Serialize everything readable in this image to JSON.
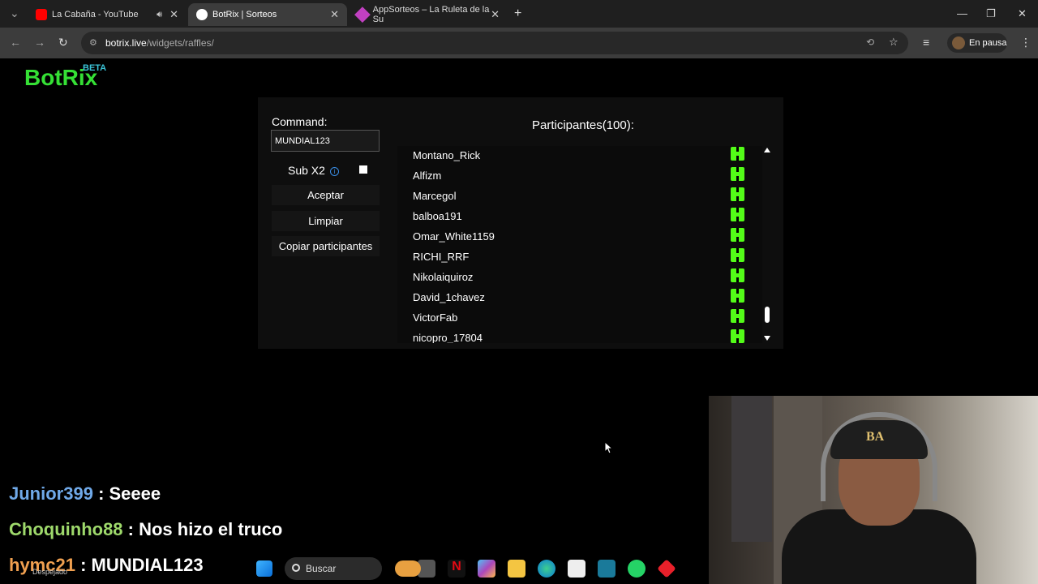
{
  "browser": {
    "tabs": [
      {
        "label": "La Cabaña - YouTube",
        "icon": "youtube-icon"
      },
      {
        "label": "BotRix | Sorteos",
        "icon": "botrix-icon"
      },
      {
        "label": "AppSorteos – La Ruleta de la Su",
        "icon": "appsorteos-icon"
      }
    ],
    "url_host": "botrix.live",
    "url_path": "/widgets/raffles/",
    "profile_label": "En pausa"
  },
  "brand": {
    "name": "BotRix",
    "badge": "BETA"
  },
  "raffle": {
    "command_label": "Command:",
    "command_value": "MUNDIAL123",
    "subx2_label": "Sub X2",
    "subx2_checked": false,
    "accept_label": "Aceptar",
    "clear_label": "Limpiar",
    "copy_label": "Copiar participantes",
    "participants_title": "Participantes(100):",
    "participants": [
      "Montano_Rick",
      "Alfizm",
      "Marcegol",
      "balboa191",
      "Omar_White1159",
      "RICHI_RRF",
      "Nikolaiquiroz",
      "David_1chavez",
      "VictorFab",
      "nicopro_17804"
    ],
    "platform_color": "#53fc18"
  },
  "chat": [
    {
      "user": "Junior399",
      "message": ": Seeee"
    },
    {
      "user": "Choquinho88",
      "message": ": Nos hizo el truco"
    },
    {
      "user": "hymc21",
      "message": ": MUNDIAL123"
    }
  ],
  "taskbar": {
    "search_label": "Buscar",
    "weather_label": "Despejado",
    "icons": [
      "windows-start-icon",
      "search-icon",
      "pizza-widget-icon",
      "task-view-icon",
      "netflix-icon",
      "copilot-icon",
      "file-explorer-icon",
      "edge-icon",
      "store-icon",
      "game-icon",
      "whatsapp-icon",
      "app-icon"
    ]
  },
  "webcam": {
    "cap_logo": "BA"
  }
}
